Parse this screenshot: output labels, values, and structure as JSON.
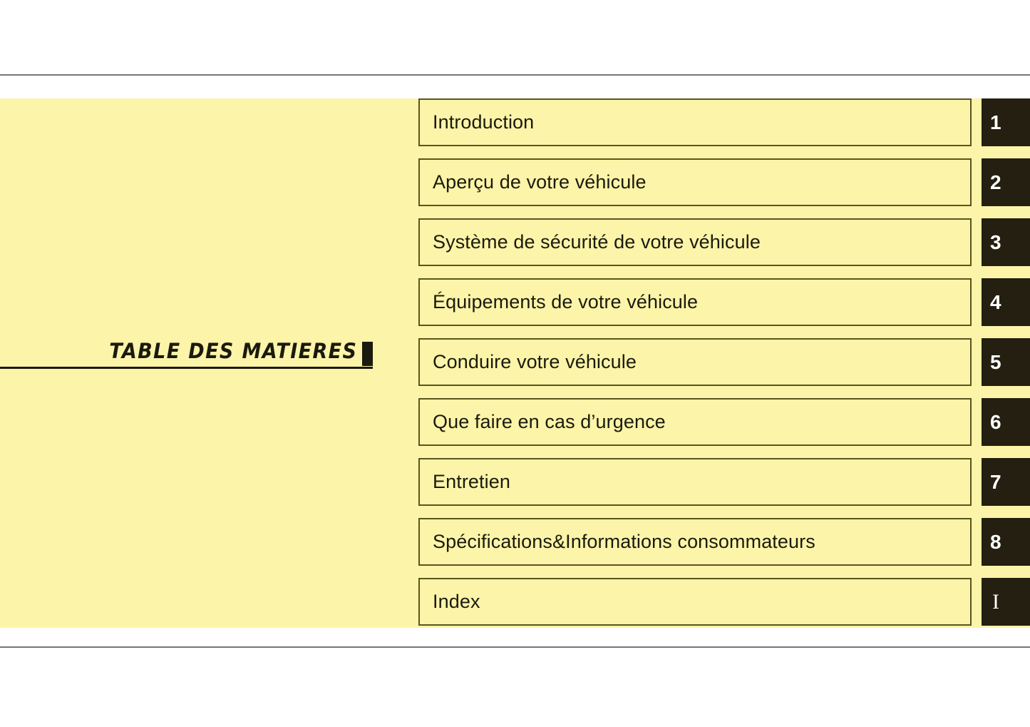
{
  "document": {
    "title": "TABLE DES MATIERES",
    "language": "fr",
    "accent_panel_color": "#fcf4a8",
    "tab_color": "#241f10",
    "border_color": "#59551f",
    "rule_color": "#767676"
  },
  "toc": {
    "heading": "TABLE DES MATIERES",
    "rows": [
      {
        "label": "Introduction",
        "tab": "1",
        "tab_style": "sans"
      },
      {
        "label": "Aperçu de votre véhicule",
        "tab": "2",
        "tab_style": "sans"
      },
      {
        "label": "Système de sécurité de votre véhicule",
        "tab": "3",
        "tab_style": "sans"
      },
      {
        "label": "Équipements de votre véhicule",
        "tab": "4",
        "tab_style": "sans"
      },
      {
        "label": "Conduire votre véhicule",
        "tab": "5",
        "tab_style": "sans"
      },
      {
        "label": "Que faire en cas d’urgence",
        "tab": "6",
        "tab_style": "sans"
      },
      {
        "label": "Entretien",
        "tab": "7",
        "tab_style": "sans"
      },
      {
        "label": "Spécifications&Informations consommateurs",
        "tab": "8",
        "tab_style": "sans"
      },
      {
        "label": "Index",
        "tab": "I",
        "tab_style": "serif"
      }
    ]
  }
}
